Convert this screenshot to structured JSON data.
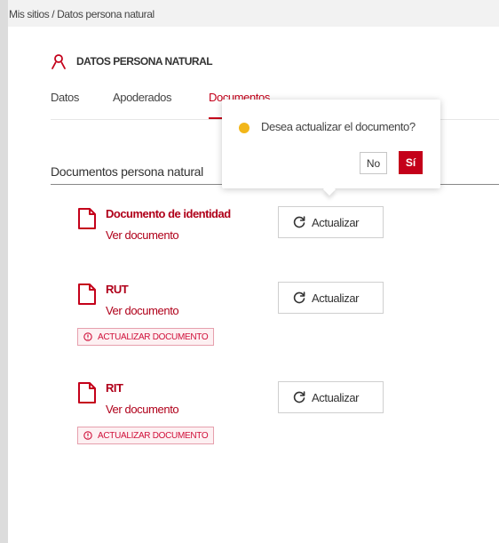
{
  "breadcrumb": {
    "text": "Mis sitios / Datos persona natural"
  },
  "section": {
    "title": "DATOS PERSONA NATURAL",
    "icon": "user-icon"
  },
  "tabs": [
    {
      "label": "Datos",
      "active": false
    },
    {
      "label": "Apoderados",
      "active": false
    },
    {
      "label": "Documentos",
      "active": true
    }
  ],
  "documents_section": {
    "title": "Documentos persona natural"
  },
  "documents": [
    {
      "name": "Documento de identidad",
      "link": "Ver documento",
      "button_label": "Actualizar",
      "warning": ""
    },
    {
      "name": "RUT",
      "link": "Ver documento",
      "button_label": "Actualizar",
      "warning": "ACTUALIZAR DOCUMENTO"
    },
    {
      "name": "RIT",
      "link": "Ver documento",
      "button_label": "Actualizar",
      "warning": "ACTUALIZAR DOCUMENTO"
    }
  ],
  "confirm_popover": {
    "message": "Desea actualizar el documento?",
    "no_label": "No",
    "yes_label": "Sí"
  },
  "colors": {
    "accent": "#c4001a",
    "warning_dot": "#f2b619",
    "badge_border": "#e6a0ad"
  }
}
